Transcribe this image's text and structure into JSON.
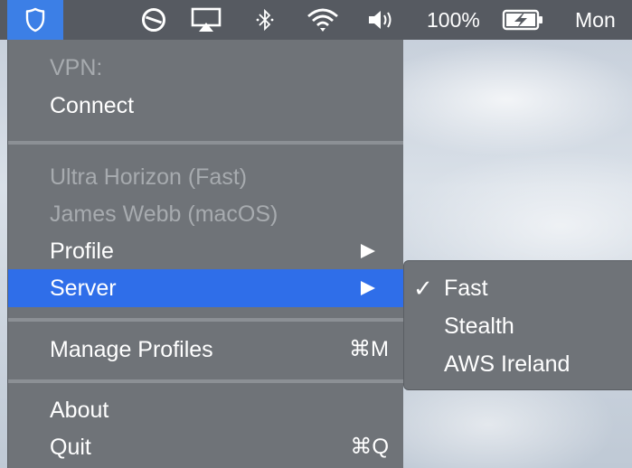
{
  "menubar": {
    "vpn_icon": "shield-icon",
    "icons": [
      "focus-circle-icon",
      "airplay-icon",
      "bluetooth-icon",
      "wifi-icon",
      "volume-icon"
    ],
    "battery_percent": "100%",
    "clock": "Mon",
    "accent": "#3c7fe6"
  },
  "menu": {
    "vpn_label": "VPN:",
    "connect": "Connect",
    "profile_name": "Ultra Horizon (Fast)",
    "account_name": "James Webb (macOS)",
    "profile": "Profile",
    "server": "Server",
    "manage_profiles": "Manage Profiles",
    "manage_profiles_shortcut": "⌘M",
    "about": "About",
    "quit": "Quit",
    "quit_shortcut": "⌘Q",
    "selected_color": "#2f6ee9"
  },
  "server_submenu": {
    "check_mark": "✓",
    "items": [
      {
        "label": "Fast",
        "checked": true
      },
      {
        "label": "Stealth",
        "checked": false
      },
      {
        "label": "AWS Ireland",
        "checked": false
      }
    ]
  }
}
